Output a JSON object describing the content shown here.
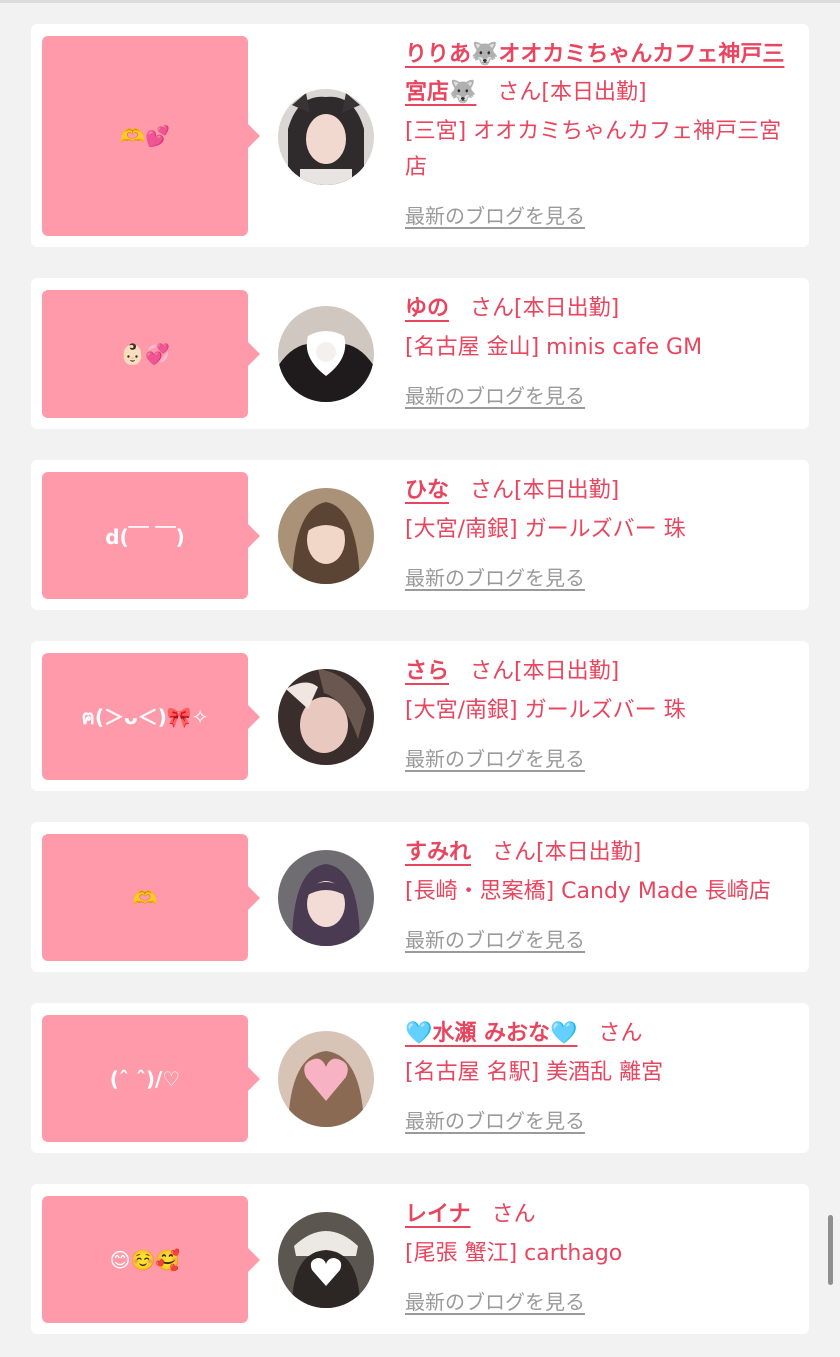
{
  "colors": {
    "accent": "#e8455f",
    "bubble": "#ff9aaa",
    "link_gray": "#9a9a9a",
    "background": "#f2f2f2"
  },
  "entries": [
    {
      "message": "🫶💕",
      "name": "りりあ🐺オオカミちゃんカフェ神戸三宮店🐺",
      "suffix": "さん[本日出勤]",
      "shop": "[三宮] オオカミちゃんカフェ神戸三宮店",
      "blog_link": "最新のブログを見る"
    },
    {
      "message": "👶🏻💞",
      "name": "ゆの",
      "suffix": "さん[本日出勤]",
      "shop": "[名古屋 金山] minis cafe GM",
      "blog_link": "最新のブログを見る"
    },
    {
      "message": "d(￣ ￣)",
      "name": "ひな",
      "suffix": "さん[本日出勤]",
      "shop": "[大宮/南銀] ガールズバー 珠",
      "blog_link": "最新のブログを見る"
    },
    {
      "message": "ฅ(＞ᴗ＜)🎀✧",
      "name": "さら",
      "suffix": "さん[本日出勤]",
      "shop": "[大宮/南銀] ガールズバー 珠",
      "blog_link": "最新のブログを見る"
    },
    {
      "message": "🫶",
      "name": "すみれ",
      "suffix": "さん[本日出勤]",
      "shop": "[長崎・思案橋] Candy Made 長崎店",
      "blog_link": "最新のブログを見る"
    },
    {
      "message": "(ˆ ˆ)/♡",
      "name": "🩵水瀬 みおな🩵",
      "suffix": "さん",
      "shop": "[名古屋 名駅] 美酒乱 離宮",
      "blog_link": "最新のブログを見る"
    },
    {
      "message": "😊☺️🥰",
      "name": "レイナ",
      "suffix": "さん",
      "shop": "[尾張 蟹江] carthago",
      "blog_link": "最新のブログを見る"
    }
  ]
}
